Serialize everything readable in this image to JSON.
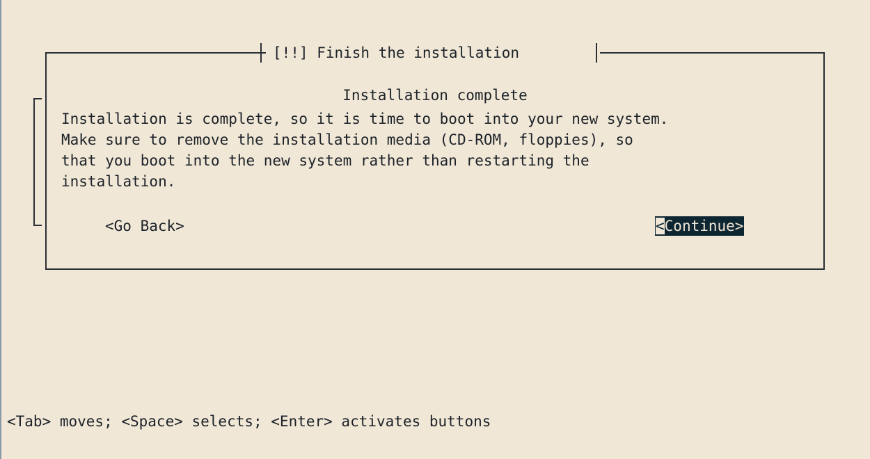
{
  "dialog": {
    "title": "[!!] Finish the installation",
    "heading": "Installation complete",
    "message_lines": [
      "Installation is complete, so it is time to boot into your new system.",
      "Make sure to remove the installation media (CD-ROM, floppies), so",
      "that you boot into the new system rather than restarting the",
      "installation."
    ],
    "buttons": {
      "go_back": "<Go Back>",
      "continue_cursor": "<",
      "continue_rest": "Continue>"
    }
  },
  "help": {
    "text": "<Tab> moves; <Space> selects; <Enter> activates buttons"
  },
  "colors": {
    "background": "#f0e7d6",
    "text": "#1c2228",
    "selected_button": "#0e2532"
  }
}
